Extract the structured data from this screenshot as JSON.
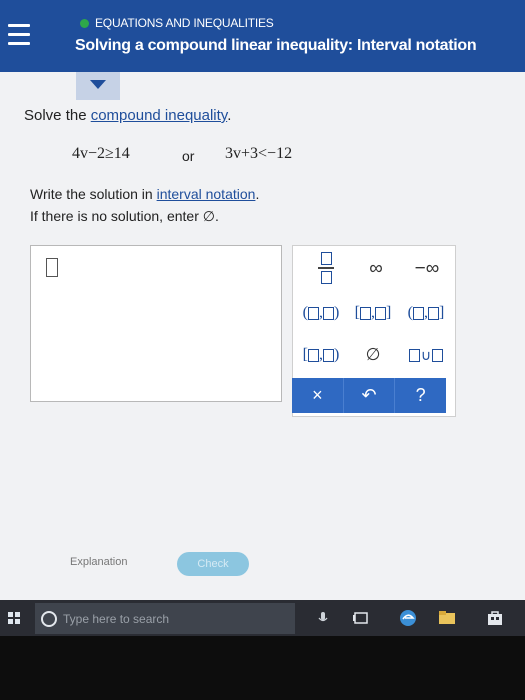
{
  "header": {
    "topic": "EQUATIONS AND INEQUALITIES",
    "title": "Solving a compound linear inequality: Interval notation"
  },
  "problem": {
    "prefix": "Solve the ",
    "link": "compound inequality",
    "suffix": ".",
    "ineq1": "4v−2≥14",
    "conj": "or",
    "ineq2": "3v+3<−12"
  },
  "instructions": {
    "line1_prefix": "Write the solution in ",
    "line1_link": "interval notation",
    "line1_suffix": ".",
    "line2": "If there is no solution, enter ∅."
  },
  "palette": {
    "infinity": "∞",
    "neg_infinity": "−∞",
    "empty_set": "∅",
    "union": "∪",
    "clear": "×",
    "undo": "↶",
    "help": "?"
  },
  "footer": {
    "explanation": "Explanation",
    "check": "Check"
  },
  "taskbar": {
    "search_placeholder": "Type here to search"
  },
  "colors": {
    "header_bg": "#1f4e9b",
    "button_blue": "#2f69c2",
    "check_button": "#8cc6e0",
    "taskbar": "#2a2c33"
  }
}
